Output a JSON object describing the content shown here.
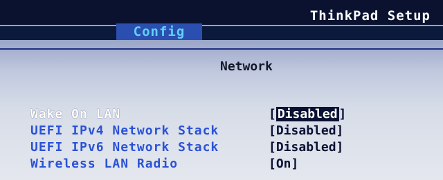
{
  "header": {
    "app_title": "ThinkPad Setup"
  },
  "tabs": [
    {
      "label": "Config",
      "active": true
    }
  ],
  "page": {
    "title": "Network"
  },
  "settings": [
    {
      "label": "Wake On LAN",
      "value": "Disabled",
      "selected": true
    },
    {
      "label": "UEFI IPv4 Network Stack",
      "value": "Disabled",
      "selected": false
    },
    {
      "label": "UEFI IPv6 Network Stack",
      "value": "Disabled",
      "selected": false
    },
    {
      "label": "Wireless LAN Radio",
      "value": "On",
      "selected": false
    }
  ],
  "colors": {
    "header_background": "#0a1230",
    "tab_background": "#2a4fb0",
    "tab_text": "#5fd2f6",
    "label_text": "#2b52d6",
    "selected_label_text": "#ffffff",
    "value_text": "#0b1133"
  }
}
